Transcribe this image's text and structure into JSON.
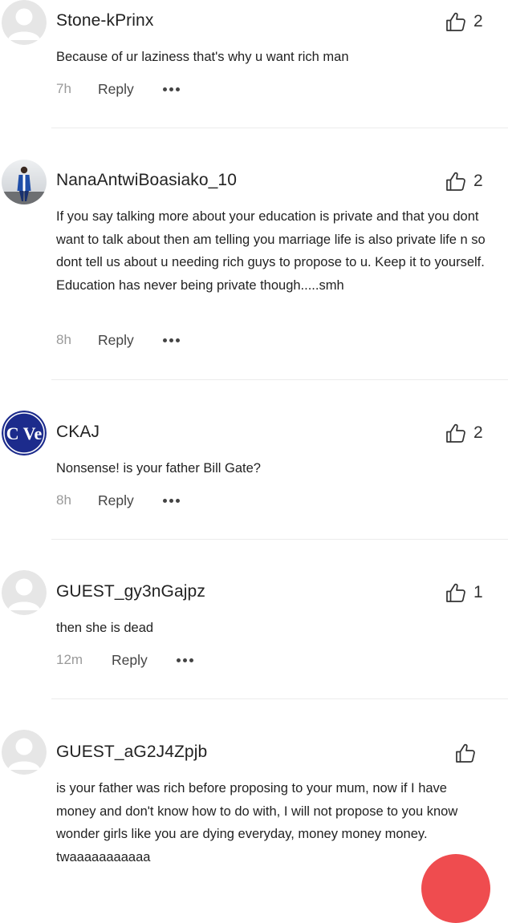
{
  "comments": [
    {
      "username": "Stone-kPrinx",
      "likes": "2",
      "body": [
        "Because of ur laziness that's why u want rich man"
      ],
      "time": "7h",
      "reply": "Reply",
      "avatar": "default-avatar"
    },
    {
      "username": "NanaAntwiBoasiako_10",
      "likes": "2",
      "body": [
        "If you say talking more about your education is private and that you dont want to talk about then am telling you marriage life is also private life n so dont tell us about u needing rich guys to propose to u. Keep it to yourself.",
        "Education has never being private though.....smh"
      ],
      "time": "8h",
      "reply": "Reply",
      "avatar": "photo-avatar"
    },
    {
      "username": "CKAJ",
      "likes": "2",
      "body": [
        "Nonsense! is your father Bill Gate?"
      ],
      "time": "8h",
      "reply": "Reply",
      "avatar": "logo-avatar",
      "avatar_text": "C Ve"
    },
    {
      "username": "GUEST_gy3nGajpz",
      "likes": "1",
      "body": [
        "then she is dead"
      ],
      "time": "12m",
      "reply": "Reply",
      "avatar": "default-avatar"
    },
    {
      "username": "GUEST_aG2J4Zpjb",
      "likes": "",
      "body": [
        "is your father was rich before proposing to your mum, now if I have money and don't know how to do with, I will not propose to you know wonder girls like you are dying everyday, money money money. twaaaaaaaaaaa"
      ],
      "avatar": "default-avatar"
    }
  ],
  "icons": {
    "like": "thumbs-up-icon",
    "more": "more-options-icon"
  },
  "colors": {
    "accent": "#ef4c4f",
    "username": "#222222",
    "timestamp": "#9a9a9a",
    "divider": "#ececec",
    "avatar_placeholder": "#e6e6e6"
  }
}
